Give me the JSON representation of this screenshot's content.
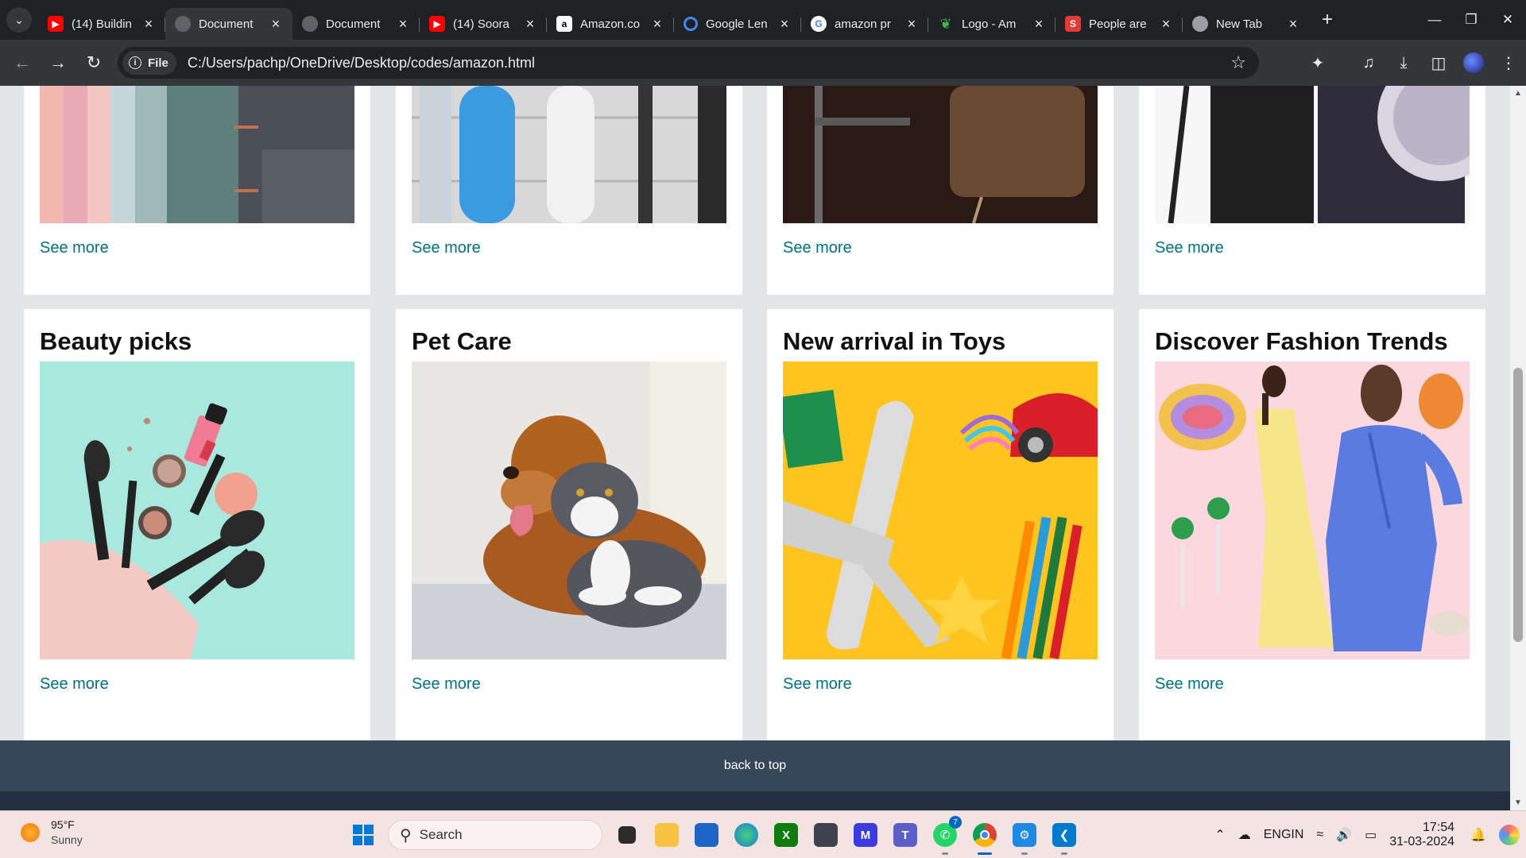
{
  "browser": {
    "tabs": [
      {
        "label": "(14) Buildin",
        "favicon": "youtube-icon",
        "color": "#ff0000"
      },
      {
        "label": "Document",
        "favicon": "globe-icon",
        "color": "#9aa0a6",
        "active": true
      },
      {
        "label": "Document",
        "favicon": "globe-icon",
        "color": "#9aa0a6"
      },
      {
        "label": "(14) Soora",
        "favicon": "youtube-icon",
        "color": "#ff0000"
      },
      {
        "label": "Amazon.co",
        "favicon": "amazon-icon",
        "color": "#ffffff"
      },
      {
        "label": "Google Len",
        "favicon": "google-lens-icon",
        "color": "#4285f4"
      },
      {
        "label": "amazon pr",
        "favicon": "google-icon",
        "color": "#ffffff"
      },
      {
        "label": "Logo - Am",
        "favicon": "leaf-icon",
        "color": "#4caf50"
      },
      {
        "label": "People are",
        "favicon": "s-icon",
        "color": "#e53935"
      },
      {
        "label": "New Tab",
        "favicon": "chrome-icon",
        "color": "#9aa0a6"
      }
    ],
    "new_tab": "+",
    "site_chip": "File",
    "url": "C:/Users/pachp/OneDrive/Desktop/codes/amazon.html"
  },
  "page": {
    "top_cards": [
      {
        "see_more": "See more"
      },
      {
        "see_more": "See more"
      },
      {
        "see_more": "See more"
      },
      {
        "see_more": "See more"
      }
    ],
    "cards": [
      {
        "title": "Beauty picks",
        "see_more": "See more"
      },
      {
        "title": "Pet Care",
        "see_more": "See more"
      },
      {
        "title": "New arrival in Toys",
        "see_more": "See more"
      },
      {
        "title": "Discover Fashion Trends",
        "see_more": "See more"
      }
    ],
    "back_to_top": "back to top"
  },
  "taskbar": {
    "weather_temp": "95°F",
    "weather_desc": "Sunny",
    "search_placeholder": "Search",
    "whatsapp_badge": "7",
    "lang_line1": "ENG",
    "lang_line2": "IN",
    "time": "17:54",
    "date": "31-03-2024"
  },
  "colors": {
    "link": "#007185",
    "back_to_top_bg": "#37475a",
    "page_bg": "#e3e6e6"
  }
}
